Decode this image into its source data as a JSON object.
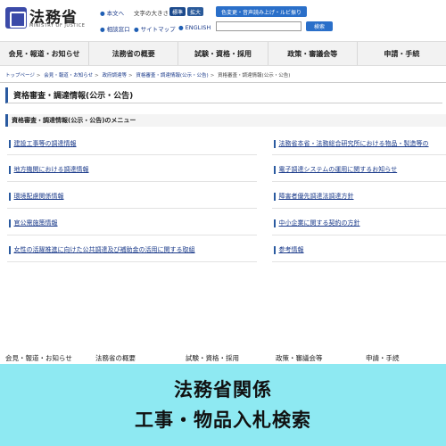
{
  "header": {
    "title": "法務省",
    "subtitle": "MINISTRY OF JUSTICE",
    "links": {
      "main_text": "本文へ",
      "consult": "相談窓口",
      "sitemap": "サイトマップ",
      "english": "ENGLISH"
    },
    "font_size_label": "文字の大きさ",
    "font_standard": "標準",
    "font_large": "拡大",
    "accessibility_button": "色変更・音声読み上げ・ルビ振り",
    "search_placeholder": "",
    "search_button": "検索"
  },
  "nav": {
    "items": [
      "会見・報道・お知らせ",
      "法務省の概要",
      "試験・資格・採用",
      "政策・審議会等",
      "申請・手続"
    ]
  },
  "breadcrumb": {
    "items": [
      "トップページ",
      "会見・報道・お知らせ",
      "政府調達等",
      "資格審査・調達情報(公示・公告)",
      "資格審査・調達情報(公示・公告)"
    ]
  },
  "page": {
    "title": "資格審査・調達情報(公示・公告)",
    "menu_heading": "資格審査・調達情報(公示・公告)のメニュー"
  },
  "menu": {
    "left": [
      "建設工事等の調達情報",
      "地方機関における調達情報",
      "環境配慮関係情報",
      "官公需施策情報",
      "女性の活躍推進に向けた公共調達及び補助金の活用に関する取組"
    ],
    "right": [
      "法務省本省・法務総合研究所における物品・製造等の",
      "電子調達システムの運用に関するお知らせ",
      "障害者優先調達法調達方針",
      "中小企業に関する契約の方針",
      "参考情報"
    ]
  },
  "footer_nav": {
    "items": [
      "会見・報道・お知らせ",
      "法務省の概要",
      "試験・資格・採用",
      "政策・審議会等",
      "申請・手続"
    ]
  },
  "banner": {
    "line1": "法務省関係",
    "line2": "工事・物品入札検索"
  }
}
